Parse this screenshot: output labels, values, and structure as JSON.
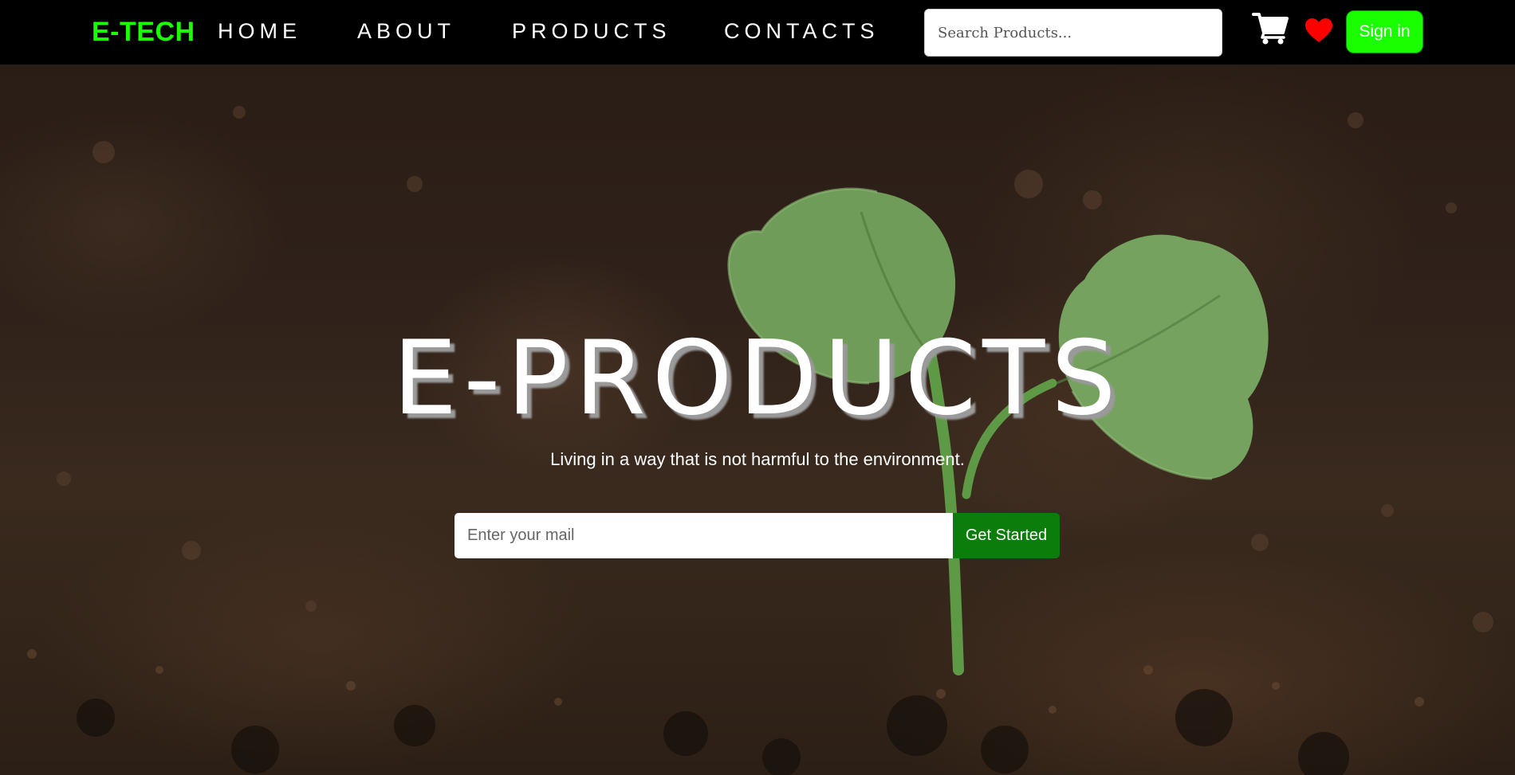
{
  "navbar": {
    "brand": "E-TECH",
    "brand_color": "#1aff00",
    "links": [
      {
        "label": "HOME"
      },
      {
        "label": "ABOUT"
      },
      {
        "label": "PRODUCTS"
      },
      {
        "label": "CONTACTS"
      }
    ],
    "search": {
      "placeholder": "Search Products...",
      "value": ""
    },
    "cart_icon": "cart-icon",
    "heart_icon": "heart-icon",
    "heart_color": "#ff0000",
    "signin_label": "Sign in",
    "signin_color": "#1aff00"
  },
  "hero": {
    "title": "E-PRODUCTS",
    "tagline": "Living in a way that is not harmful to the environment.",
    "email_input": {
      "placeholder": "Enter your mail",
      "value": ""
    },
    "cta_label": "Get Started",
    "cta_color": "#0a7d0a"
  }
}
